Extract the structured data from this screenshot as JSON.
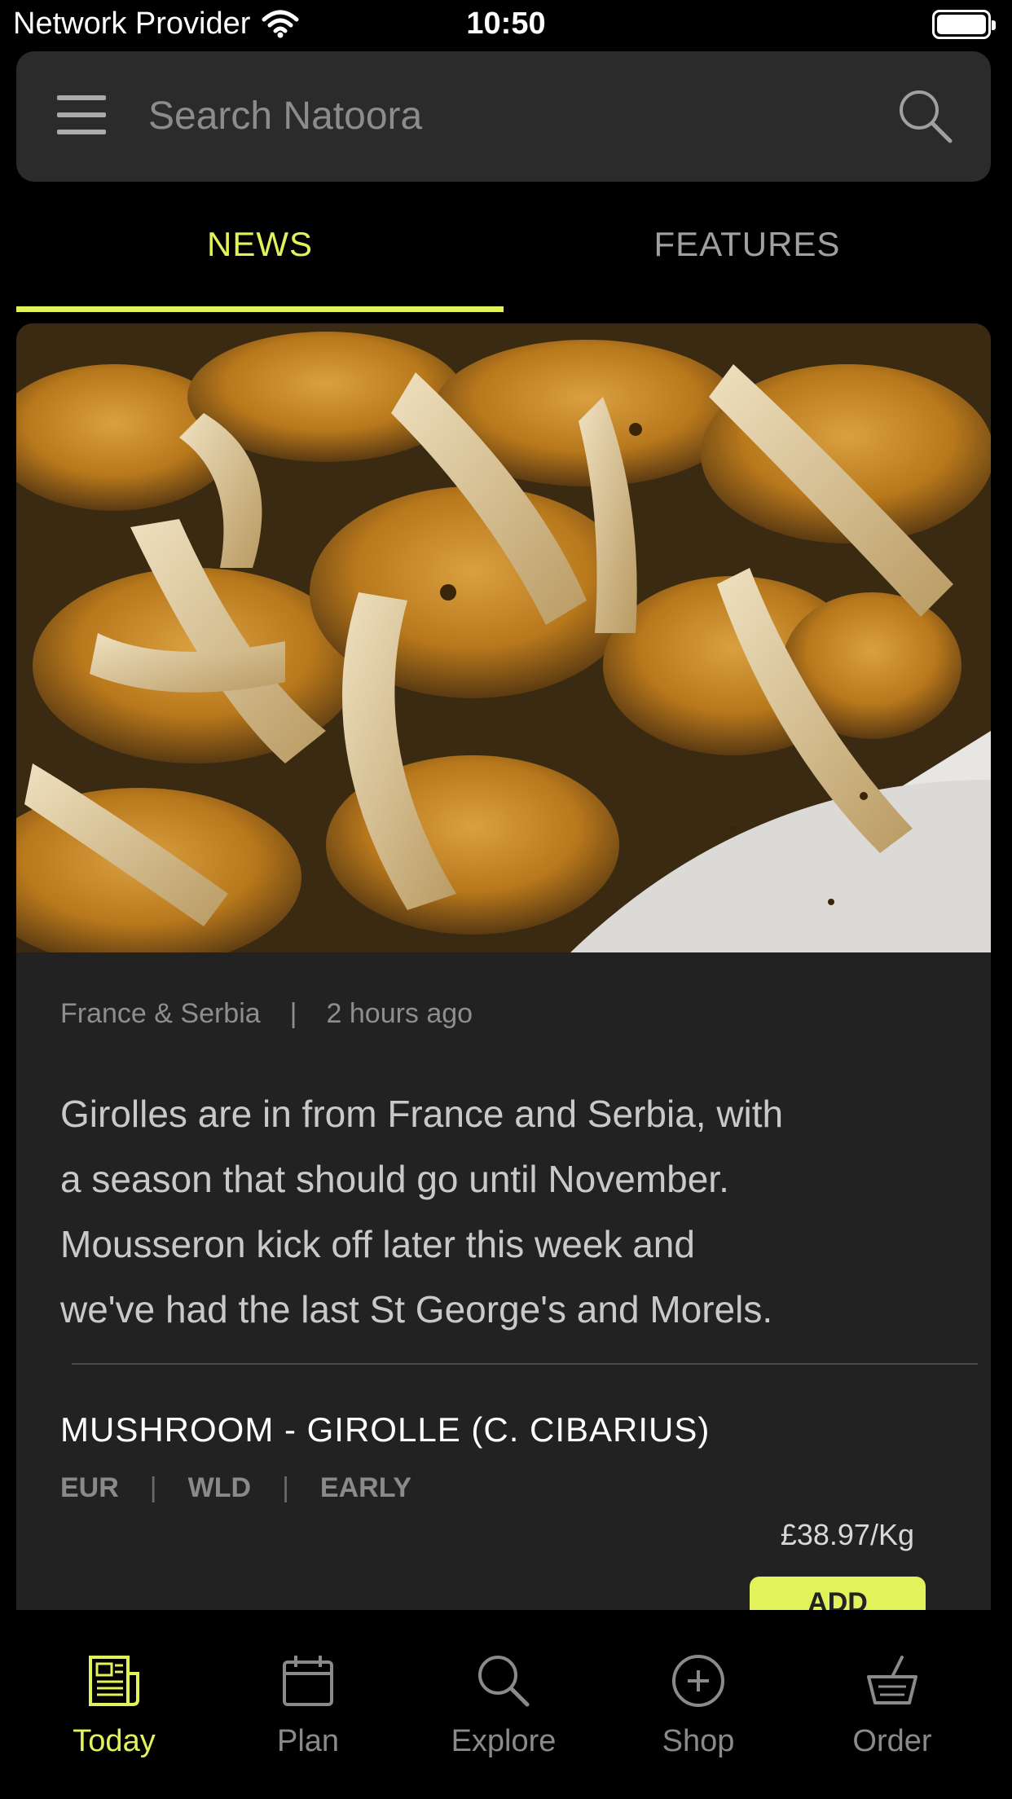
{
  "status_bar": {
    "carrier": "Network Provider",
    "time": "10:50",
    "battery_level": 1.0
  },
  "search": {
    "placeholder": "Search Natoora"
  },
  "tabs": [
    {
      "label": "NEWS",
      "active": true
    },
    {
      "label": "FEATURES",
      "active": false
    }
  ],
  "news_card": {
    "image": "chanterelle-mushrooms-photo",
    "origin": "France & Serbia",
    "meta_separator": "|",
    "time_ago": "2 hours ago",
    "body_lines": [
      "Girolles are in from France and Serbia, with",
      "a season that should go until November.",
      "Mousseron kick off later this week and",
      "we've had the last St George's and Morels."
    ],
    "product": {
      "name": "MUSHROOM - GIROLLE (C. CIBARIUS)",
      "tags": [
        "EUR",
        "WLD",
        "EARLY"
      ],
      "tag_separator": "|",
      "price": "£38.97/Kg",
      "add_label": "ADD"
    }
  },
  "bottom_nav": [
    {
      "label": "Today",
      "icon": "news-icon",
      "active": true
    },
    {
      "label": "Plan",
      "icon": "calendar-icon",
      "active": false
    },
    {
      "label": "Explore",
      "icon": "search-icon",
      "active": false
    },
    {
      "label": "Shop",
      "icon": "plus-circle-icon",
      "active": false
    },
    {
      "label": "Order",
      "icon": "basket-icon",
      "active": false
    }
  ],
  "colors": {
    "accent": "#e2f25a",
    "background": "#000000",
    "card": "#222222",
    "search_bar": "#2b2b2b"
  }
}
